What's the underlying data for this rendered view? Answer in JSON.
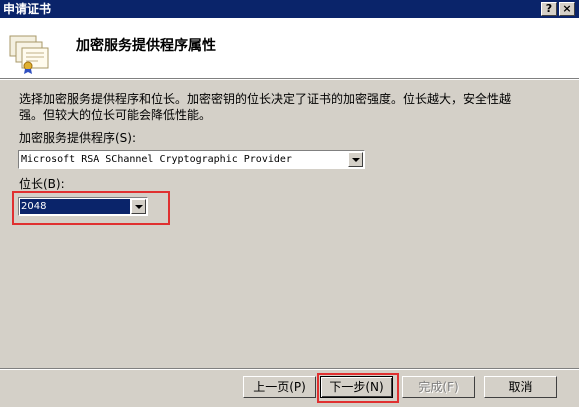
{
  "window": {
    "title": "申请证书",
    "help_label": "?",
    "close_label": "×"
  },
  "header": {
    "heading": "加密服务提供程序属性",
    "icon": "certificate-icon"
  },
  "description": "选择加密服务提供程序和位长。加密密钥的位长决定了证书的加密强度。位长越大，安全性越强。但较大的位长可能会降低性能。",
  "csp": {
    "label": "加密服务提供程序(S):",
    "value": "Microsoft RSA SChannel Cryptographic Provider"
  },
  "bitlength": {
    "label": "位长(B):",
    "value": "2048"
  },
  "buttons": {
    "back": "上一页(P)",
    "next": "下一步(N)",
    "finish": "完成(F)",
    "cancel": "取消"
  },
  "colors": {
    "titlebar": "#0a246a",
    "face": "#d4d0c8",
    "highlight_box": "#e03030"
  }
}
